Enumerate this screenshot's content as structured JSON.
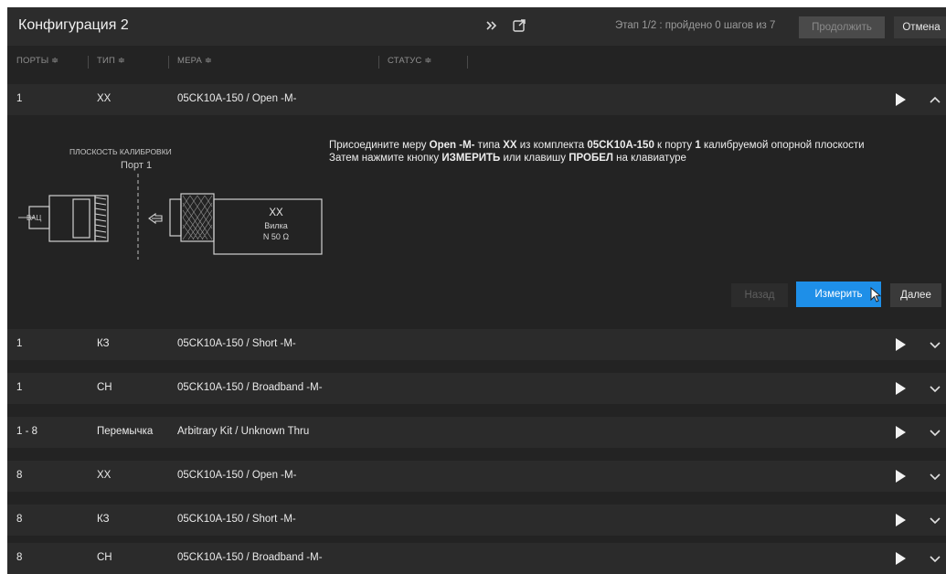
{
  "window": {
    "title": "Конфигурация 2",
    "stage_text": "Этап 1/2 : пройдено 0 шагов из 7",
    "continue_label": "Продолжить",
    "cancel_label": "Отмена"
  },
  "columns": {
    "ports": "ПОРТЫ ≑",
    "type": "ТИП ≑",
    "standard": "МЕРА ≑",
    "status": "СТАТУС ≑"
  },
  "rows": [
    {
      "port": "1",
      "type": "ХХ",
      "standard": "05CK10A-150 / Open -M-",
      "expanded": true
    },
    {
      "port": "1",
      "type": "КЗ",
      "standard": "05CK10A-150 / Short -M-"
    },
    {
      "port": "1",
      "type": "СН",
      "standard": "05CK10A-150 / Broadband -M-"
    },
    {
      "port": "1 - 8",
      "type": "Перемычка",
      "standard": "Arbitrary Kit / Unknown Thru"
    },
    {
      "port": "8",
      "type": "ХХ",
      "standard": "05CK10A-150 / Open -M-"
    },
    {
      "port": "8",
      "type": "КЗ",
      "standard": "05CK10A-150 / Short -M-"
    },
    {
      "port": "8",
      "type": "СН",
      "standard": "05CK10A-150 / Broadband -M-"
    }
  ],
  "instruction": {
    "l1_pre": "Присоедините меру ",
    "l1_std": "Open -M-",
    "l1_mid1": " типа ",
    "l1_type": "ХХ",
    "l1_mid2": " из комплекта ",
    "l1_kit": "05CK10A-150",
    "l1_mid3": " к порту ",
    "l1_port": "1",
    "l1_post": " калибруемой опорной плоскости",
    "l2_pre": "Затем нажмите кнопку ",
    "l2_btn": "ИЗМЕРИТЬ",
    "l2_mid": " или клавишу ",
    "l2_key": "ПРОБЕЛ",
    "l2_post": " на клавиатуре"
  },
  "diagram": {
    "plane_label": "ПЛОСКОСТЬ КАЛИБРОВКИ",
    "port_label": "Порт 1",
    "vna_label": "ВАЦ",
    "std_type": "ХХ",
    "std_desc": "Вилка",
    "std_conn": "N 50 Ω"
  },
  "actions": {
    "back_label": "Назад",
    "measure_label": "Измерить",
    "next_label": "Далее"
  },
  "colors": {
    "accent": "#1e8fe8",
    "background": "#232323",
    "row": "#2b2b2b"
  }
}
